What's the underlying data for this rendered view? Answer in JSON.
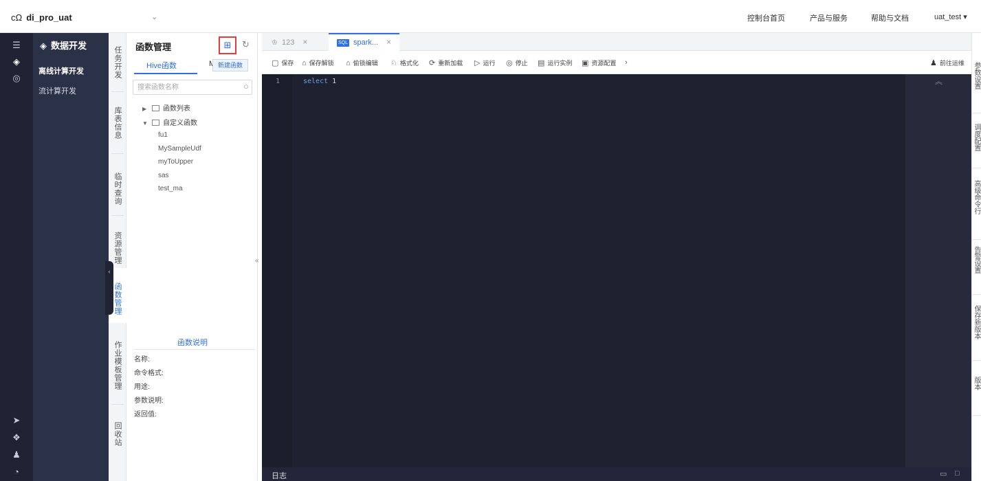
{
  "topbar": {
    "project": "di_pro_uat",
    "dropdown_caret": "⌄",
    "nav": [
      "控制台首页",
      "产品与服务",
      "帮助与文档"
    ],
    "user": "uat_test ▾"
  },
  "icon_rail": {
    "icons": [
      "layers-icon",
      "data-dev-icon",
      "cube-icon",
      "send-icon",
      "stack-icon",
      "ops-icon",
      "clock-icon"
    ]
  },
  "nav_side": {
    "header": "数据开发",
    "items": [
      "离线计算开发",
      "流计算开发"
    ],
    "active_index": 0
  },
  "vtabs": {
    "items": [
      "任务开发",
      "库表信息",
      "临时查询",
      "资源管理",
      "函数管理",
      "作业模板管理",
      "回收站"
    ],
    "active_index": 4
  },
  "function_panel": {
    "title": "函数管理",
    "new_tooltip": "新建函数",
    "tabs": [
      "Hive函数",
      "M"
    ],
    "search_placeholder": "搜索函数名称",
    "tree": [
      {
        "label": "函数列表",
        "expanded": false
      },
      {
        "label": "自定义函数",
        "expanded": true
      }
    ],
    "leaves": [
      "fu1",
      "MySampleUdf",
      "myToUpper",
      "sas",
      "test_ma"
    ],
    "description": {
      "title": "函数说明",
      "rows": [
        "名称:",
        "命令格式:",
        "用途:",
        "参数说明:",
        "返回值:"
      ]
    }
  },
  "editor": {
    "tabs": [
      {
        "label": "123",
        "active": false
      },
      {
        "label": "spark...",
        "active": true,
        "badge": "SQL"
      }
    ],
    "toolbar": [
      {
        "icon": "save-icon",
        "glyph": "▢",
        "label": "保存"
      },
      {
        "icon": "unlock-icon",
        "glyph": "⌂",
        "label": "保存解锁"
      },
      {
        "icon": "lock-icon",
        "glyph": "⌂",
        "label": "偷锁编辑"
      },
      {
        "icon": "format-icon",
        "glyph": "♘",
        "label": "格式化"
      },
      {
        "icon": "reload-icon",
        "glyph": "⟳",
        "label": "重新加载"
      },
      {
        "icon": "run-icon",
        "glyph": "▷",
        "label": "运行"
      },
      {
        "icon": "stop-icon",
        "glyph": "◎",
        "label": "停止"
      },
      {
        "icon": "instance-icon",
        "glyph": "▤",
        "label": "运行实例"
      },
      {
        "icon": "resource-icon",
        "glyph": "▣",
        "label": "资源配置"
      },
      {
        "icon": "chevron-right-icon",
        "glyph": "›",
        "label": ""
      }
    ],
    "goto_ops": "前往运维",
    "line_number": "1",
    "code_keyword": "select",
    "code_value": "1",
    "status_log": "日志"
  },
  "right_panel": {
    "tabs": [
      "参数设置",
      "调度配置",
      "高级命令行",
      "告警设置",
      "保存新版本",
      "版本"
    ]
  },
  "colors": {
    "accent": "#2f6fdf",
    "rail": "#1f2334",
    "nav": "#2b3146",
    "editor_bg": "#1e2130",
    "highlight_border": "#e43b3b"
  }
}
